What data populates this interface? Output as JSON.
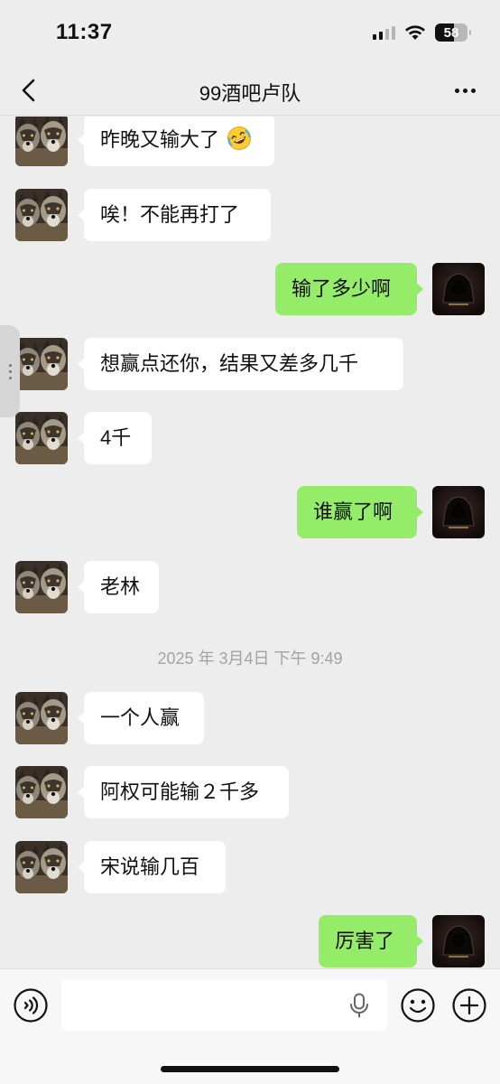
{
  "status_bar": {
    "time": "11:37",
    "battery_level": "58"
  },
  "nav": {
    "title": "99酒吧卢队"
  },
  "messages": [
    {
      "side": "left",
      "text": "昨晚又输大了",
      "emoji": "rolling-on-floor-laughing"
    },
    {
      "side": "left",
      "text": "唉！不能再打了"
    },
    {
      "side": "right",
      "text": "输了多少啊"
    },
    {
      "side": "left",
      "text": "想赢点还你，结果又差多几千"
    },
    {
      "side": "left",
      "text": "4千"
    },
    {
      "side": "right",
      "text": "谁赢了啊"
    },
    {
      "side": "left",
      "text": "老林"
    },
    {
      "side": "left",
      "text": "一个人赢"
    },
    {
      "side": "left",
      "text": "阿权可能输２千多"
    },
    {
      "side": "left",
      "text": "宋说输几百"
    },
    {
      "side": "right",
      "text": "厉害了"
    }
  ],
  "timestamp": "2025 年 3月4日 下午 9:49",
  "input": {
    "value": ""
  },
  "colors": {
    "background": "#ededed",
    "sent_bubble": "#95ec69",
    "received_bubble": "#ffffff"
  },
  "icons": [
    "back-chevron-icon",
    "more-icon",
    "voice-icon",
    "mic-icon",
    "emoji-icon",
    "plus-icon",
    "wolf-avatar",
    "hooded-figure-avatar"
  ]
}
